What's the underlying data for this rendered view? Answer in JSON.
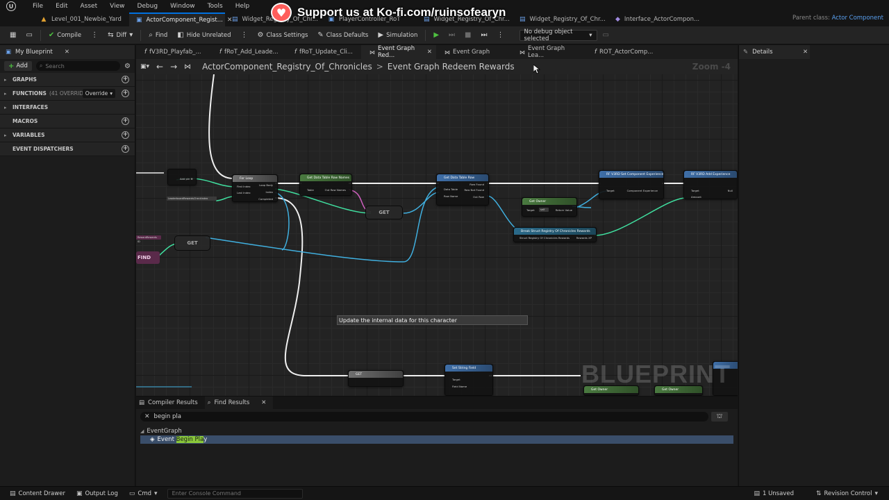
{
  "menu": [
    "File",
    "Edit",
    "Asset",
    "View",
    "Debug",
    "Window",
    "Tools",
    "Help"
  ],
  "doc_tabs": [
    {
      "label": "Level_001_Newbie_Yard",
      "icon": "level-icon",
      "active": false
    },
    {
      "label": "ActorComponent_Regist...",
      "icon": "blueprint-icon",
      "active": true
    },
    {
      "label": "Widget_Registry_Of_Chr...",
      "icon": "widget-icon",
      "active": false
    },
    {
      "label": "PlayerController_RoT",
      "icon": "blueprint-icon",
      "active": false
    },
    {
      "label": "Widget_Registry_Of_Chr...",
      "icon": "widget-icon",
      "active": false
    },
    {
      "label": "Widget_Registry_Of_Chr...",
      "icon": "widget-icon",
      "active": false
    },
    {
      "label": "Interface_ActorCompon...",
      "icon": "interface-icon",
      "active": false
    }
  ],
  "parent_class": {
    "label": "Parent class:",
    "value": "Actor Component"
  },
  "kofi": {
    "text": "Support us at Ko-fi.com/ruinsofearyn"
  },
  "toolbar": {
    "compile": "Compile",
    "diff": "Diff",
    "find": "Find",
    "hide_unrelated": "Hide Unrelated",
    "class_settings": "Class Settings",
    "class_defaults": "Class Defaults",
    "simulation": "Simulation",
    "debug_object": "No debug object selected"
  },
  "left_panel": {
    "title": "My Blueprint",
    "add": "Add",
    "search_placeholder": "Search",
    "sections": [
      {
        "label": "GRAPHS",
        "has_add": true
      },
      {
        "label": "FUNCTIONS",
        "sub": "(41 OVERRIDABLE)",
        "override": "Override",
        "has_add": true
      },
      {
        "label": "INTERFACES",
        "has_add": false
      },
      {
        "label": "MACROS",
        "has_add": true
      },
      {
        "label": "VARIABLES",
        "has_add": true
      },
      {
        "label": "EVENT DISPATCHERS",
        "has_add": true
      }
    ]
  },
  "graph_tabs": [
    {
      "label": "fV3RD_Playfab_...",
      "kind": "function",
      "active": false
    },
    {
      "label": "fRoT_Add_Leade...",
      "kind": "function",
      "active": false
    },
    {
      "label": "fRoT_Update_Cli...",
      "kind": "function",
      "active": false
    },
    {
      "label": "Event Graph Red...",
      "kind": "event",
      "active": true
    },
    {
      "label": "Event Graph",
      "kind": "event",
      "active": false
    },
    {
      "label": "Event Graph Lea...",
      "kind": "event",
      "active": false
    },
    {
      "label": "ROT_ActorComp...",
      "kind": "function",
      "active": false
    }
  ],
  "breadcrumb": [
    "ActorComponent_Registry_Of_Chronicles",
    "Event Graph Redeem Rewards"
  ],
  "zoom": "Zoom -4",
  "watermark": "BLUEPRINT",
  "nodes": {
    "for_loop": "For Loop",
    "get_row_names": "Get Data Table Row Names",
    "get_row": "Get Data Table Row",
    "get_owner": "Get Owner",
    "set_experience": "RF V3RD Set Component Experience",
    "add_experience": "RF V3RD Add Experience",
    "break_struct": "Break Struct Registry Of Chronicles Rewards",
    "get_label": "GET",
    "find_label": "FIND",
    "set_string_field": "Set String Field",
    "comment": "Update the internal data for this character"
  },
  "details": {
    "title": "Details"
  },
  "bottom": {
    "tabs": [
      "Compiler Results",
      "Find Results"
    ],
    "search_value": "begin pla",
    "tree": {
      "group": "EventGraph",
      "result_prefix": "Event ",
      "result_match": "Begin Pla",
      "result_suffix": "y"
    }
  },
  "statusbar": {
    "content_drawer": "Content Drawer",
    "output_log": "Output Log",
    "cmd": "Cmd",
    "console_placeholder": "Enter Console Command",
    "unsaved": "1 Unsaved",
    "revision_control": "Revision Control"
  }
}
